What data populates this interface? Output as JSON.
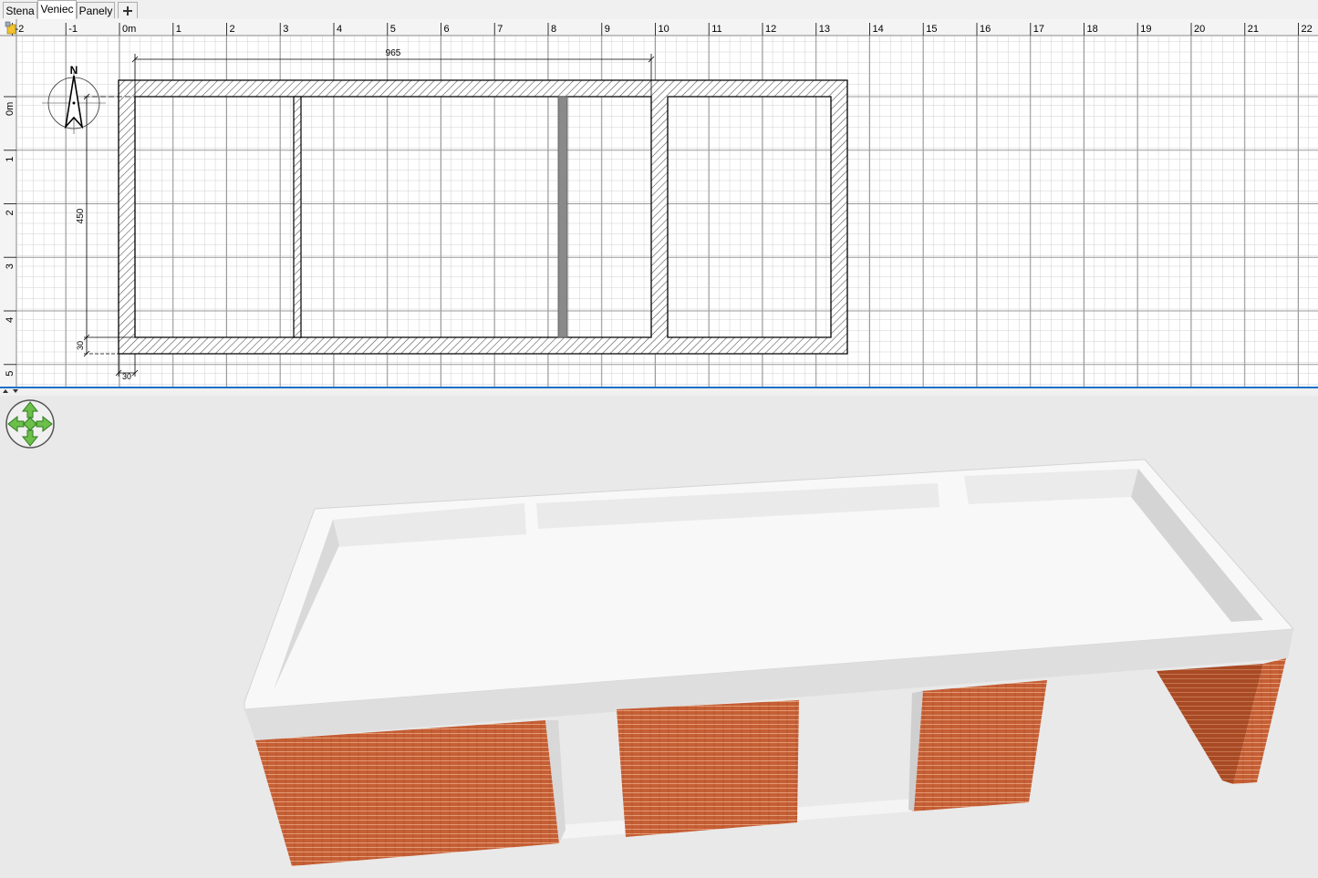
{
  "tabs": [
    {
      "label": "Stena",
      "active": false
    },
    {
      "label": "Veniec",
      "active": true
    },
    {
      "label": "Panely",
      "active": false
    }
  ],
  "add_tab_icon": "plus-icon",
  "plan": {
    "ruler_x_labels": [
      "-2",
      "-1",
      "0m",
      "1",
      "2",
      "3",
      "4",
      "5",
      "6",
      "7",
      "8",
      "9",
      "10",
      "11",
      "12",
      "13",
      "14",
      "15",
      "16",
      "17",
      "18",
      "19",
      "20",
      "21",
      "22"
    ],
    "ruler_y_labels": [
      "0m",
      "1",
      "2",
      "3",
      "4",
      "5"
    ],
    "dimension_width": "965",
    "dimension_height": "450",
    "dimension_wall_vertical": "30",
    "dimension_wall_horizontal": "30",
    "compass_label": "N"
  },
  "navigator_icon": "navigation-arrows-icon",
  "colors": {
    "accent": "#1a6fc9",
    "brick": "#c45e34",
    "wall_top": "#f7f7f7",
    "background_3d": "#e9e9e9"
  }
}
